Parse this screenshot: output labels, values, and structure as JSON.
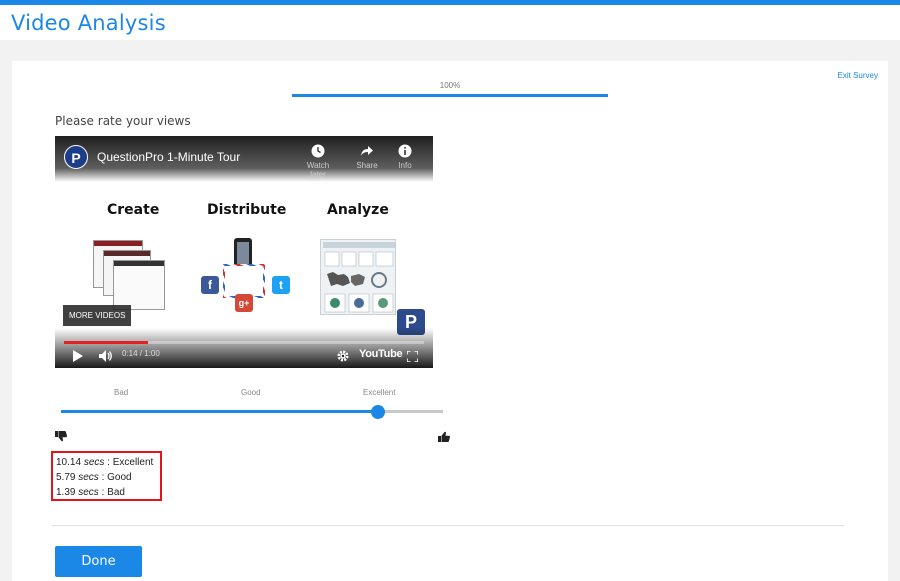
{
  "header": {
    "title": "Video Analysis"
  },
  "survey": {
    "exit_label": "Exit Survey",
    "progress_text": "100%",
    "progress_value": 1.0,
    "question": "Please rate your views"
  },
  "video": {
    "title": "QuestionPro 1-Minute Tour",
    "logo_letter": "P",
    "watch_later": "Watch later",
    "share": "Share",
    "info": "Info",
    "columns": [
      "Create",
      "Distribute",
      "Analyze"
    ],
    "more_videos": "MORE VIDEOS",
    "time": "0:14 / 1:00",
    "played_fraction": 0.233,
    "platform": "YouTube",
    "social": {
      "facebook": "f",
      "googleplus": "g+",
      "twitter": "t"
    }
  },
  "rating": {
    "labels": [
      "Bad",
      "Good",
      "Excellent"
    ],
    "value_fraction": 0.83
  },
  "results": [
    {
      "secs": "10.14",
      "unit": "secs",
      "rating": "Excellent"
    },
    {
      "secs": "5.79",
      "unit": "secs",
      "rating": "Good"
    },
    {
      "secs": "1.39",
      "unit": "secs",
      "rating": "Bad"
    }
  ],
  "actions": {
    "done_label": "Done"
  },
  "colors": {
    "accent": "#1b87e6",
    "highlight_border": "#e1141b",
    "scrub_played": "#e52020"
  }
}
